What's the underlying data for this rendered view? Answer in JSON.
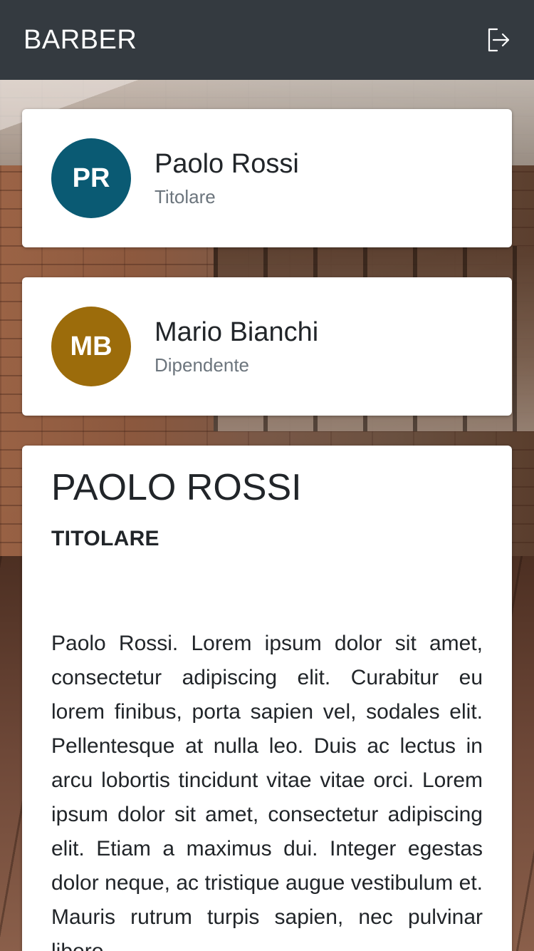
{
  "header": {
    "title": "BARBER",
    "logout_icon": "logout-icon"
  },
  "people": [
    {
      "initials": "PR",
      "name": "Paolo Rossi",
      "role": "Titolare",
      "avatar_color": "#0a5a73"
    },
    {
      "initials": "MB",
      "name": "Mario Bianchi",
      "role": "Dipendente",
      "avatar_color": "#9c6c0b"
    }
  ],
  "detail": {
    "title": "PAOLO ROSSI",
    "role": "TITOLARE",
    "description": "Paolo Rossi. Lorem ipsum dolor sit amet, consectetur adipiscing elit. Curabitur eu lorem finibus, porta sapien vel, sodales elit. Pellentesque at nulla leo. Duis ac lectus in arcu lobortis tincidunt vitae vitae orci. Lorem ipsum dolor sit amet, consectetur adipiscing elit. Etiam a maximus dui. Integer egestas dolor neque, ac tristique augue vestibulum et. Mauris rutrum turpis sapien, nec pulvinar libero"
  },
  "colors": {
    "header_bg": "#343a40",
    "card_bg": "#ffffff",
    "text_primary": "#212529",
    "text_secondary": "#6c757d"
  }
}
